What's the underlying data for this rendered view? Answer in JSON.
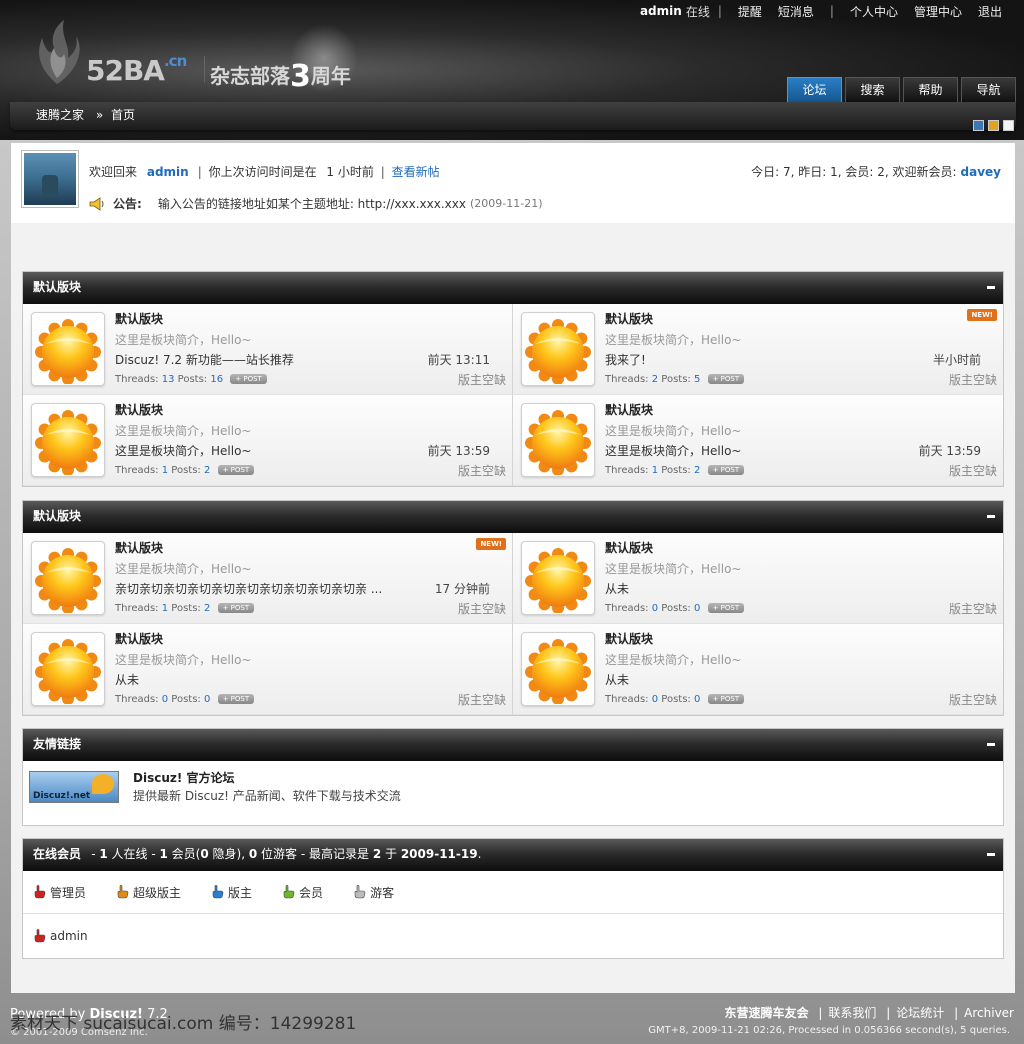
{
  "topbar": {
    "username": "admin",
    "status": "在线",
    "links": [
      "提醒",
      "短消息",
      "个人中心",
      "管理中心",
      "退出"
    ]
  },
  "logo": {
    "brand": "52BA",
    "brand_suffix": ".cn",
    "tagline_a": "杂志部落",
    "tagline_three": "3",
    "tagline_b": "周年"
  },
  "nav": {
    "tabs": [
      "论坛",
      "搜索",
      "帮助",
      "导航"
    ],
    "active": "论坛"
  },
  "breadcrumb": {
    "home": "速腾之家",
    "arrow": "»",
    "current": "首页"
  },
  "skins": [
    "#3a78b5",
    "#e8a020",
    "#f5f5f5"
  ],
  "welcome": {
    "prefix": "欢迎回来",
    "username": "admin",
    "last_visit_label": "你上次访问时间是在",
    "last_visit_value": "1 小时前",
    "view_new": "查看新帖",
    "stats_text": "今日: 7, 昨日: 1, 会员: 2, 欢迎新会员:",
    "new_member": "davey"
  },
  "announcement": {
    "label": "公告:",
    "text": "输入公告的链接地址如某个主题地址: http://xxx.xxx.xxx",
    "date": "(2009-11-21)"
  },
  "sections": [
    {
      "title": "默认版块",
      "forums": [
        {
          "name": "默认版块",
          "desc": "这里是板块简介，Hello~",
          "last_post": "Discuz! 7.2 新功能——站长推荐",
          "last_time": "前天 13:11",
          "threads": "13",
          "posts": "16",
          "moderator": "版主空缺",
          "is_new": false
        },
        {
          "name": "默认版块",
          "desc": "这里是板块简介，Hello~",
          "last_post": "我来了!",
          "last_time": "半小时前",
          "threads": "2",
          "posts": "5",
          "moderator": "版主空缺",
          "is_new": true
        },
        {
          "name": "默认版块",
          "desc": "这里是板块简介，Hello~",
          "last_post": "这里是板块简介，Hello~",
          "last_time": "前天 13:59",
          "threads": "1",
          "posts": "2",
          "moderator": "版主空缺",
          "is_new": false
        },
        {
          "name": "默认版块",
          "desc": "这里是板块简介，Hello~",
          "last_post": "这里是板块简介，Hello~",
          "last_time": "前天 13:59",
          "threads": "1",
          "posts": "2",
          "moderator": "版主空缺",
          "is_new": false
        }
      ]
    },
    {
      "title": "默认版块",
      "forums": [
        {
          "name": "默认版块",
          "desc": "这里是板块简介，Hello~",
          "last_post": "亲切亲切亲切亲切亲切亲切亲切亲切亲切亲切亲 ...",
          "last_time": "17 分钟前",
          "threads": "1",
          "posts": "2",
          "moderator": "版主空缺",
          "is_new": true
        },
        {
          "name": "默认版块",
          "desc": "这里是板块简介，Hello~",
          "last_post": "从未",
          "last_time": "",
          "threads": "0",
          "posts": "0",
          "moderator": "版主空缺",
          "is_new": false
        },
        {
          "name": "默认版块",
          "desc": "这里是板块简介，Hello~",
          "last_post": "从未",
          "last_time": "",
          "threads": "0",
          "posts": "0",
          "moderator": "版主空缺",
          "is_new": false
        },
        {
          "name": "默认版块",
          "desc": "这里是板块简介，Hello~",
          "last_post": "从未",
          "last_time": "",
          "threads": "0",
          "posts": "0",
          "moderator": "版主空缺",
          "is_new": false
        }
      ]
    }
  ],
  "labels": {
    "threads": "Threads:",
    "posts": "Posts:",
    "post_button": "+ POST",
    "new_badge": "NEW!"
  },
  "links_section": {
    "title": "友情链接",
    "logo_text": "Discuz!.net",
    "name": "Discuz! 官方论坛",
    "desc": "提供最新 Discuz! 产品新闻、软件下载与技术交流"
  },
  "online": {
    "title": "在线会员",
    "summary_parts": [
      "- ",
      "1",
      " 人在线 - ",
      "1",
      " 会员(",
      "0",
      " 隐身), ",
      "0",
      " 位游客 - 最高记录是 ",
      "2",
      " 于 ",
      "2009-11-19",
      "."
    ],
    "legend": [
      {
        "label": "管理员",
        "color": "#cc2222"
      },
      {
        "label": "超级版主",
        "color": "#e08a1a"
      },
      {
        "label": "版主",
        "color": "#2a7fd0"
      },
      {
        "label": "会员",
        "color": "#6cb82a"
      },
      {
        "label": "游客",
        "color": "#bbbbbb"
      }
    ],
    "users": [
      {
        "name": "admin",
        "color": "#cc2222"
      }
    ]
  },
  "footer": {
    "powered": "Powered by",
    "brand": "Discuz!",
    "version": "7.2",
    "copyright": "© 2001-2009 Comsenz Inc.",
    "watermark": "素材天下 sucaisucai.com    编号：14299281",
    "site": "东营速腾车友会",
    "links": [
      "联系我们",
      "论坛统计",
      "Archiver"
    ],
    "debug": "GMT+8, 2009-11-21 02:26, Processed in 0.056366 second(s), 5 queries."
  }
}
